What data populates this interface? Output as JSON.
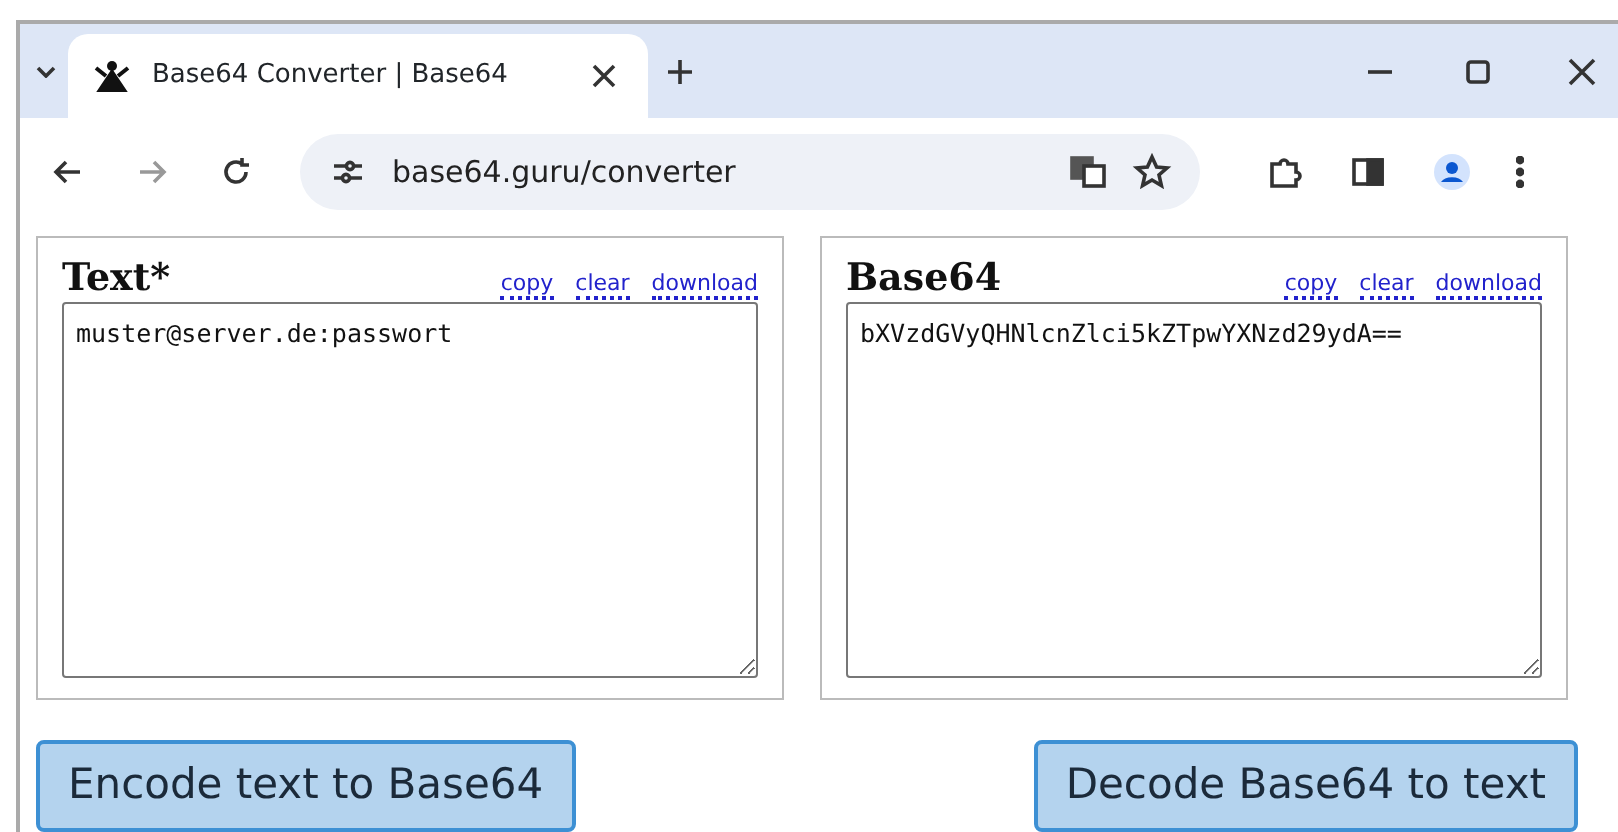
{
  "browser": {
    "tab": {
      "title": "Base64 Converter | Base64",
      "selected": true
    },
    "url": "base64.guru/converter"
  },
  "panels": [
    {
      "title": "Text*",
      "actions": [
        "copy",
        "clear",
        "download"
      ],
      "value": "muster@server.de:passwort"
    },
    {
      "title": "Base64",
      "actions": [
        "copy",
        "clear",
        "download"
      ],
      "value": "bXVzdGVyQHNlcnZlci5kZTpwYXNzd29ydA=="
    }
  ],
  "buttons": [
    "Encode text to Base64",
    "Decode Base64 to text"
  ]
}
